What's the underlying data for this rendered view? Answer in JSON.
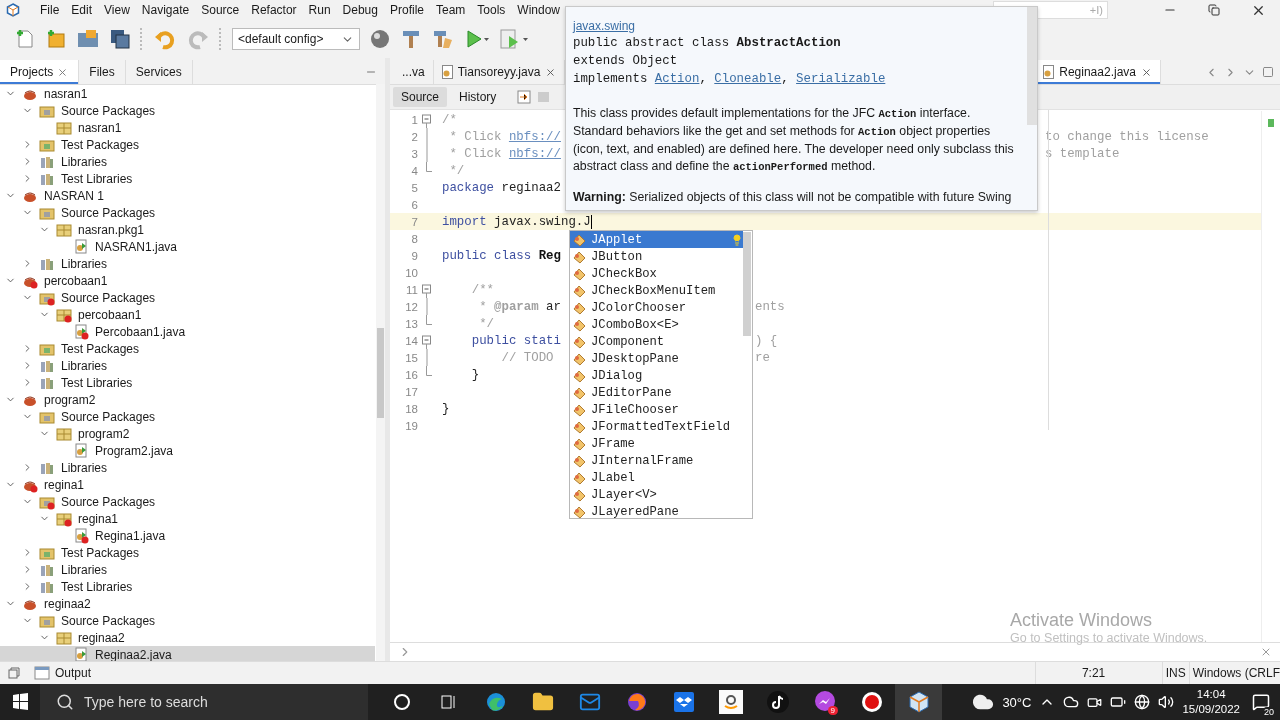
{
  "menu_bar": {
    "items": [
      "File",
      "Edit",
      "View",
      "Navigate",
      "Source",
      "Refactor",
      "Run",
      "Debug",
      "Profile",
      "Team",
      "Tools",
      "Window"
    ]
  },
  "search": {
    "placeholder": "+I)"
  },
  "toolbar": {
    "config": "<default config>"
  },
  "projects_panel": {
    "tabs": [
      {
        "label": "Projects",
        "selected": true,
        "closable": true
      },
      {
        "label": "Files",
        "selected": false,
        "closable": false
      },
      {
        "label": "Services",
        "selected": false,
        "closable": false
      }
    ],
    "tree": [
      {
        "label": "nasran1",
        "kind": "project",
        "expanded": true,
        "selected": false,
        "children": [
          {
            "label": "Source Packages",
            "kind": "source-packages",
            "expanded": true,
            "selected": false,
            "children": [
              {
                "label": "nasran1",
                "kind": "package",
                "selected": false
              }
            ]
          },
          {
            "label": "Test Packages",
            "kind": "test-packages",
            "expanded": false,
            "selected": false
          },
          {
            "label": "Libraries",
            "kind": "libraries",
            "expanded": false,
            "selected": false
          },
          {
            "label": "Test Libraries",
            "kind": "libraries",
            "expanded": false,
            "selected": false
          }
        ]
      },
      {
        "label": "NASRAN 1",
        "kind": "project",
        "expanded": true,
        "selected": false,
        "children": [
          {
            "label": "Source Packages",
            "kind": "source-packages",
            "expanded": true,
            "selected": false,
            "children": [
              {
                "label": "nasran.pkg1",
                "kind": "package",
                "expanded": true,
                "selected": false,
                "children": [
                  {
                    "label": "NASRAN1.java",
                    "kind": "java-file",
                    "selected": false
                  }
                ]
              }
            ]
          },
          {
            "label": "Libraries",
            "kind": "libraries",
            "expanded": false,
            "selected": false
          }
        ]
      },
      {
        "label": "percobaan1",
        "kind": "project-error",
        "expanded": true,
        "selected": false,
        "children": [
          {
            "label": "Source Packages",
            "kind": "source-packages-error",
            "expanded": true,
            "selected": false,
            "children": [
              {
                "label": "percobaan1",
                "kind": "package-error",
                "expanded": true,
                "selected": false,
                "children": [
                  {
                    "label": "Percobaan1.java",
                    "kind": "java-file-error",
                    "selected": false
                  }
                ]
              }
            ]
          },
          {
            "label": "Test Packages",
            "kind": "test-packages",
            "expanded": false,
            "selected": false
          },
          {
            "label": "Libraries",
            "kind": "libraries",
            "expanded": false,
            "selected": false
          },
          {
            "label": "Test Libraries",
            "kind": "libraries",
            "expanded": false,
            "selected": false
          }
        ]
      },
      {
        "label": "program2",
        "kind": "project",
        "expanded": true,
        "selected": false,
        "children": [
          {
            "label": "Source Packages",
            "kind": "source-packages",
            "expanded": true,
            "selected": false,
            "children": [
              {
                "label": "program2",
                "kind": "package",
                "expanded": true,
                "selected": false,
                "children": [
                  {
                    "label": "Program2.java",
                    "kind": "java-file",
                    "selected": false
                  }
                ]
              }
            ]
          },
          {
            "label": "Libraries",
            "kind": "libraries",
            "expanded": false,
            "selected": false
          }
        ]
      },
      {
        "label": "regina1",
        "kind": "project-error",
        "expanded": true,
        "selected": false,
        "children": [
          {
            "label": "Source Packages",
            "kind": "source-packages-error",
            "expanded": true,
            "selected": false,
            "children": [
              {
                "label": "regina1",
                "kind": "package-error",
                "expanded": true,
                "selected": false,
                "children": [
                  {
                    "label": "Regina1.java",
                    "kind": "java-file-error",
                    "selected": false
                  }
                ]
              }
            ]
          },
          {
            "label": "Test Packages",
            "kind": "test-packages",
            "expanded": false,
            "selected": false
          },
          {
            "label": "Libraries",
            "kind": "libraries",
            "expanded": false,
            "selected": false
          },
          {
            "label": "Test Libraries",
            "kind": "libraries",
            "expanded": false,
            "selected": false
          }
        ]
      },
      {
        "label": "reginaa2",
        "kind": "project",
        "expanded": true,
        "selected": false,
        "children": [
          {
            "label": "Source Packages",
            "kind": "source-packages",
            "expanded": true,
            "selected": false,
            "children": [
              {
                "label": "reginaa2",
                "kind": "package",
                "expanded": true,
                "selected": false,
                "children": [
                  {
                    "label": "Reginaa2.java",
                    "kind": "java-file",
                    "selected": true
                  }
                ]
              }
            ]
          }
        ]
      }
    ]
  },
  "editor": {
    "tabs": [
      {
        "label": "...va",
        "selected": false,
        "closable": false
      },
      {
        "label": "Tiansoreyy.java",
        "selected": false,
        "closable": true
      },
      {
        "label": "Reginaa2.java",
        "selected": true,
        "closable": true
      }
    ],
    "view_tabs": [
      {
        "label": "Source",
        "selected": true
      },
      {
        "label": "History",
        "selected": false
      }
    ],
    "lines": [
      {
        "number": "1",
        "fold": {
          "kind": "start"
        },
        "tokens": [
          {
            "kind": "comment",
            "text": "/*"
          }
        ]
      },
      {
        "number": "2",
        "fold": {
          "kind": "inside"
        },
        "tokens": [
          {
            "kind": "comment",
            "text": " * Click "
          },
          {
            "kind": "link",
            "text": "nbfs://"
          }
        ],
        "after_doc_popup": "to change this license"
      },
      {
        "number": "3",
        "fold": {
          "kind": "inside"
        },
        "tokens": [
          {
            "kind": "comment",
            "text": " * Click "
          },
          {
            "kind": "link",
            "text": "nbfs://"
          }
        ],
        "after_doc_popup": "s template"
      },
      {
        "number": "4",
        "fold": {
          "kind": "end"
        },
        "tokens": [
          {
            "kind": "comment",
            "text": " */"
          }
        ]
      },
      {
        "number": "5",
        "tokens": [
          {
            "kind": "keyword",
            "text": "package"
          },
          {
            "kind": "plain",
            "text": " reginaa2"
          }
        ]
      },
      {
        "number": "6"
      },
      {
        "number": "7",
        "current": true,
        "tokens": [
          {
            "kind": "keyword",
            "text": "import"
          },
          {
            "kind": "plain",
            "text": " javax.swing.J"
          }
        ]
      },
      {
        "number": "8",
        "current": false
      },
      {
        "number": "9",
        "tokens": [
          {
            "kind": "keyword",
            "text": "public class"
          },
          {
            "kind": "bold",
            "text": " Reg"
          }
        ]
      },
      {
        "number": "10"
      },
      {
        "number": "11",
        "fold": {
          "kind": "start"
        },
        "tokens": [
          {
            "kind": "comment",
            "text": "    /**"
          }
        ]
      },
      {
        "number": "12",
        "fold": {
          "kind": "inside"
        },
        "tokens": [
          {
            "kind": "comment",
            "text": "     * "
          },
          {
            "kind": "tag",
            "text": "@param"
          },
          {
            "kind": "plain",
            "text": " ar"
          }
        ],
        "after_completion": "ents"
      },
      {
        "number": "13",
        "fold": {
          "kind": "end"
        },
        "tokens": [
          {
            "kind": "comment",
            "text": "     */"
          }
        ]
      },
      {
        "number": "14",
        "fold": {
          "kind": "start"
        },
        "tokens": [
          {
            "kind": "keyword",
            "text": "    public stati"
          }
        ],
        "after_completion": ") {"
      },
      {
        "number": "15",
        "fold": {
          "kind": "inside"
        },
        "tokens": [
          {
            "kind": "comment",
            "text": "        // TODO"
          }
        ],
        "after_completion": "re"
      },
      {
        "number": "16",
        "fold": {
          "kind": "end"
        },
        "tokens": [
          {
            "kind": "plain",
            "text": "    }"
          }
        ]
      },
      {
        "number": "17"
      },
      {
        "number": "18",
        "tokens": [
          {
            "kind": "plain",
            "text": "}"
          }
        ]
      },
      {
        "number": "19"
      }
    ]
  },
  "doc_popup": {
    "package_link": "javax.swing",
    "signature": [
      [
        {
          "kind": "text",
          "text": "public abstract class "
        },
        {
          "kind": "bold",
          "text": "AbstractAction"
        }
      ],
      [
        {
          "kind": "text",
          "text": "extends Object"
        }
      ],
      [
        {
          "kind": "text",
          "text": "implements "
        },
        {
          "kind": "link",
          "text": "Action"
        },
        {
          "kind": "text",
          "text": ", "
        },
        {
          "kind": "link",
          "text": "Cloneable"
        },
        {
          "kind": "text",
          "text": ", "
        },
        {
          "kind": "link",
          "text": "Serializable"
        }
      ]
    ],
    "description": [
      {
        "kind": "text",
        "text": "This class provides default implementations for the JFC "
      },
      {
        "kind": "code",
        "text": "Action"
      },
      {
        "kind": "text",
        "text": " interface. Standard behaviors like the get and set methods for "
      },
      {
        "kind": "code",
        "text": "Action"
      },
      {
        "kind": "text",
        "text": " object properties (icon, text, and enabled) are defined here. The developer need only subclass this abstract class and define the "
      },
      {
        "kind": "code",
        "text": "actionPerformed"
      },
      {
        "kind": "text",
        "text": " method."
      }
    ],
    "warning": "**Warning:** Serialized objects of this class will not be compatible with future Swing"
  },
  "completion": {
    "items": [
      {
        "label": "JApplet",
        "selected": true
      },
      {
        "label": "JButton",
        "selected": false
      },
      {
        "label": "JCheckBox",
        "selected": false
      },
      {
        "label": "JCheckBoxMenuItem",
        "selected": false
      },
      {
        "label": "JColorChooser",
        "selected": false
      },
      {
        "label": "JComboBox<E>",
        "selected": false
      },
      {
        "label": "JComponent",
        "selected": false
      },
      {
        "label": "JDesktopPane",
        "selected": false
      },
      {
        "label": "JDialog",
        "selected": false
      },
      {
        "label": "JEditorPane",
        "selected": false
      },
      {
        "label": "JFileChooser",
        "selected": false
      },
      {
        "label": "JFormattedTextField",
        "selected": false
      },
      {
        "label": "JFrame",
        "selected": false
      },
      {
        "label": "JInternalFrame",
        "selected": false
      },
      {
        "label": "JLabel",
        "selected": false
      },
      {
        "label": "JLayer<V>",
        "selected": false
      },
      {
        "label": "JLayeredPane",
        "selected": false
      }
    ]
  },
  "activation_notice": {
    "title": "Activate Windows",
    "subtitle": "Go to Settings to activate Windows."
  },
  "bottom_bar": {
    "output_tab": "Output",
    "position": "7:21",
    "insert_mode": "INS",
    "line_endings": "Windows (CRLF"
  },
  "taskbar": {
    "search_placeholder": "Type here to search",
    "apps": [
      {
        "kind": "cortana",
        "selected": false
      },
      {
        "kind": "task-view",
        "selected": false
      },
      {
        "kind": "edge",
        "selected": false
      },
      {
        "kind": "explorer",
        "selected": false
      },
      {
        "kind": "mail",
        "selected": false
      },
      {
        "kind": "firefox",
        "selected": false
      },
      {
        "kind": "dropbox",
        "selected": false
      },
      {
        "kind": "store-a",
        "selected": false
      },
      {
        "kind": "tiktok",
        "selected": false
      },
      {
        "kind": "messenger",
        "selected": false,
        "badge": "9"
      },
      {
        "kind": "recorder",
        "selected": false
      },
      {
        "kind": "netbeans",
        "selected": true
      }
    ],
    "weather": "30°C",
    "time": "14:04",
    "date": "15/09/2022",
    "notifications": "20"
  }
}
